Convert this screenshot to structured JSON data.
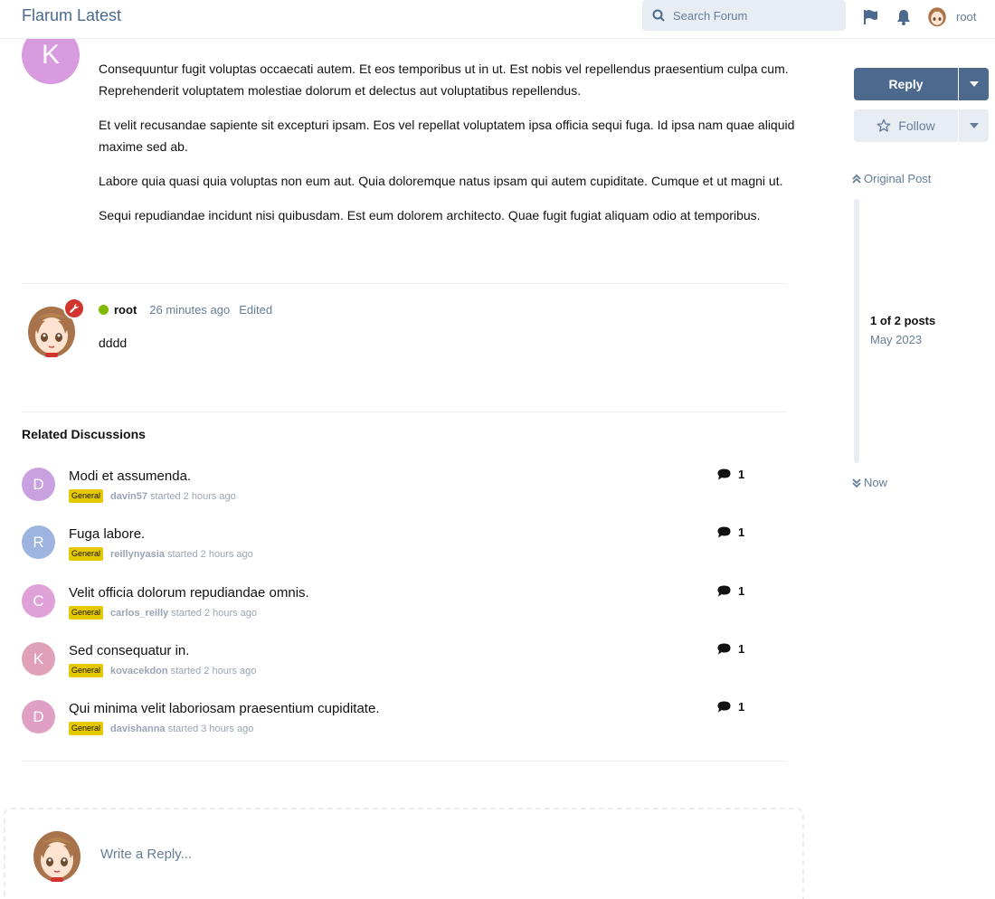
{
  "header": {
    "brand": "Flarum Latest",
    "search_placeholder": "Search Forum",
    "username": "root"
  },
  "post1": {
    "avatar_letter": "K",
    "avatar_color": "#d99be0",
    "paragraphs": [
      "Consequuntur fugit voluptas occaecati autem. Et eos temporibus ut in ut. Est nobis vel repellendus praesentium culpa cum. Reprehenderit voluptatem molestiae dolorum et delectus aut voluptatibus repellendus.",
      "Et velit recusandae sapiente sit excepturi ipsam. Eos vel repellat voluptatem ipsa officia sequi fuga. Id ipsa nam quae aliquid maxime sed ab.",
      "Labore quia quasi quia voluptas non eum aut. Quia doloremque natus ipsam qui autem cupiditate. Cumque et ut magni ut.",
      "Sequi repudiandae incidunt nisi quibusdam. Est eum dolorem architecto. Quae fugit fugiat aliquam odio at temporibus."
    ]
  },
  "post2": {
    "username": "root",
    "time": "26 minutes ago",
    "edited": "Edited",
    "content": "dddd"
  },
  "related": {
    "title": "Related Discussions",
    "items": [
      {
        "letter": "D",
        "color": "#c9a0e0",
        "title": "Modi et assumenda.",
        "tag": "General",
        "author": "davin57",
        "started": "started 2 hours ago",
        "replies": "1"
      },
      {
        "letter": "R",
        "color": "#9db3e0",
        "title": "Fuga labore.",
        "tag": "General",
        "author": "reillynyasia",
        "started": "started 2 hours ago",
        "replies": "1"
      },
      {
        "letter": "C",
        "color": "#e0a0d8",
        "title": "Velit officia dolorum repudiandae omnis.",
        "tag": "General",
        "author": "carlos_reilly",
        "started": "started 2 hours ago",
        "replies": "1"
      },
      {
        "letter": "K",
        "color": "#e0a0b8",
        "title": "Sed consequatur in.",
        "tag": "General",
        "author": "kovacekdon",
        "started": "started 2 hours ago",
        "replies": "1"
      },
      {
        "letter": "D",
        "color": "#e0a0c4",
        "title": "Qui minima velit laboriosam praesentium cupiditate.",
        "tag": "General",
        "author": "davishanna",
        "started": "started 3 hours ago",
        "replies": "1"
      }
    ]
  },
  "composer": {
    "placeholder": "Write a Reply..."
  },
  "sidebar": {
    "reply_label": "Reply",
    "follow_label": "Follow",
    "original_post": "Original Post",
    "count": "1 of 2 posts",
    "date": "May 2023",
    "now": "Now"
  },
  "colors": {
    "primary": "#4d698e",
    "muted": "#667d99",
    "tag": "#e5c800",
    "online": "#7fba00",
    "mod_badge": "#d0342c"
  }
}
